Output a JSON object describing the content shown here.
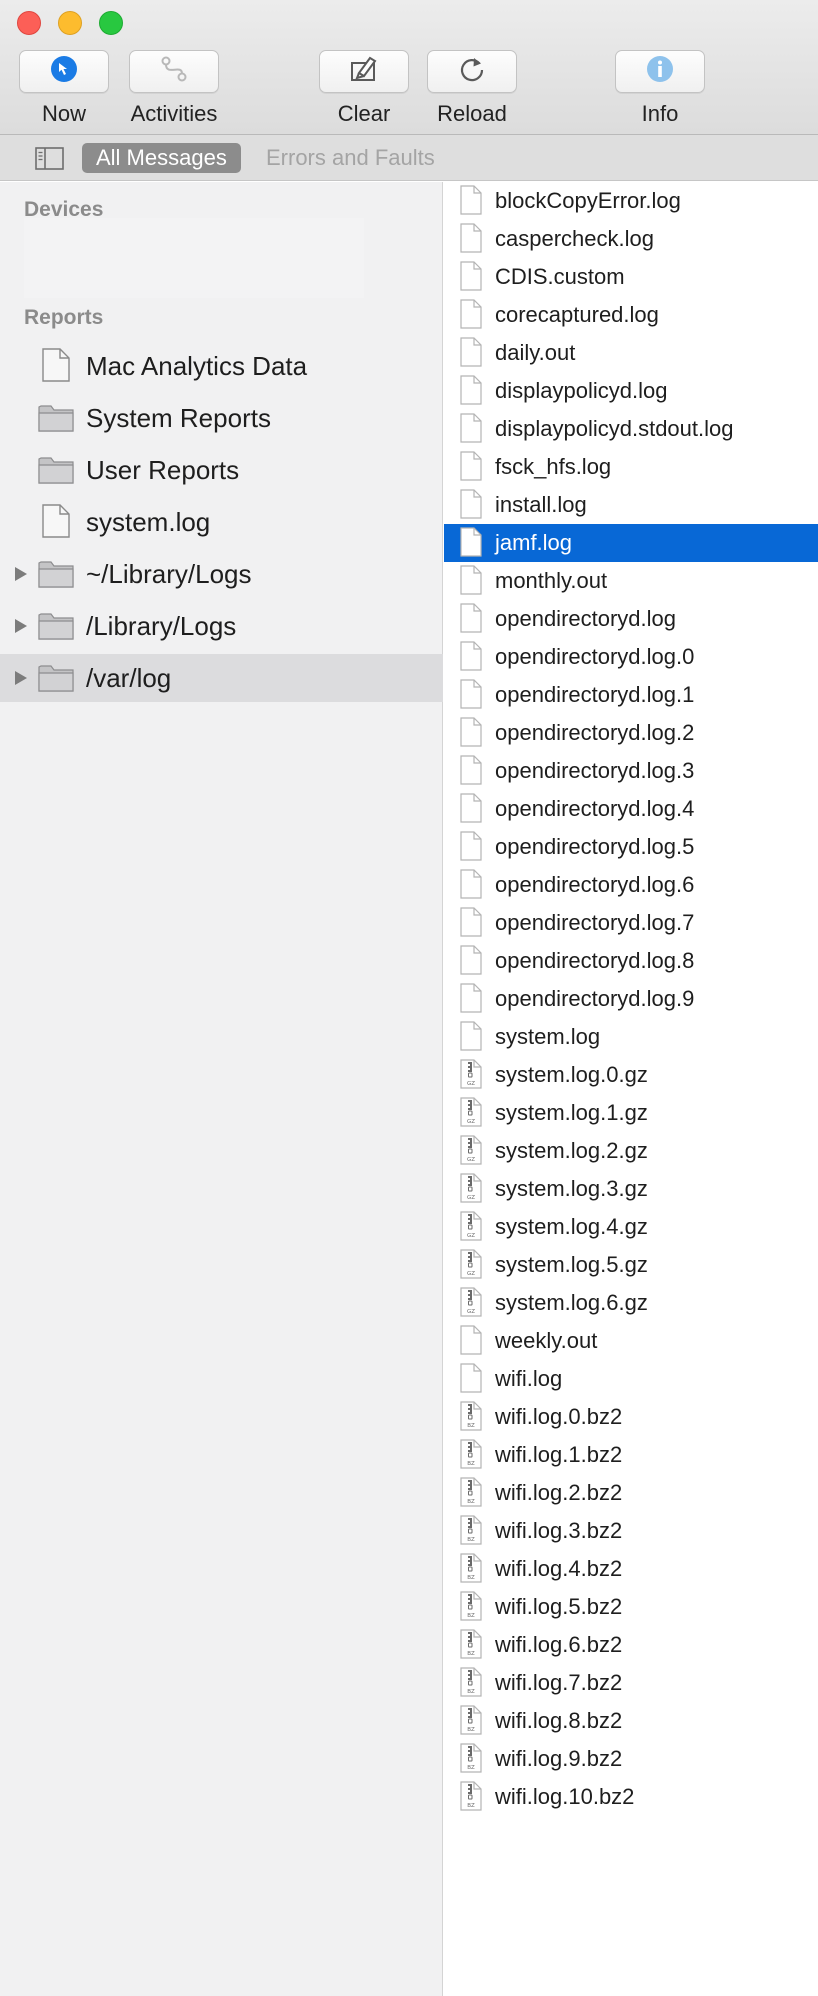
{
  "toolbar": {
    "buttons": [
      {
        "label": "Now",
        "icon": "now-arrow-icon"
      },
      {
        "label": "Activities",
        "icon": "activities-icon"
      },
      {
        "label": "Clear",
        "icon": "clear-icon"
      },
      {
        "label": "Reload",
        "icon": "reload-icon"
      },
      {
        "label": "Info",
        "icon": "info-icon"
      }
    ]
  },
  "filter_bar": {
    "all_messages": "All Messages",
    "errors_and_faults": "Errors and Faults"
  },
  "sidebar": {
    "devices_header": "Devices",
    "reports_header": "Reports",
    "items": [
      {
        "label": "Mac Analytics Data",
        "icon": "document-icon"
      },
      {
        "label": "System Reports",
        "icon": "folder-icon"
      },
      {
        "label": "User Reports",
        "icon": "folder-icon"
      },
      {
        "label": "system.log",
        "icon": "document-icon"
      },
      {
        "label": "~/Library/Logs",
        "icon": "folder-icon",
        "expandable": true
      },
      {
        "label": "/Library/Logs",
        "icon": "folder-icon",
        "expandable": true
      },
      {
        "label": "/var/log",
        "icon": "folder-icon",
        "expandable": true,
        "selected": true
      }
    ]
  },
  "files": [
    {
      "name": "blockCopyError.log",
      "type": "doc"
    },
    {
      "name": "caspercheck.log",
      "type": "doc"
    },
    {
      "name": "CDIS.custom",
      "type": "doc"
    },
    {
      "name": "corecaptured.log",
      "type": "doc"
    },
    {
      "name": "daily.out",
      "type": "doc"
    },
    {
      "name": "displaypolicyd.log",
      "type": "doc"
    },
    {
      "name": "displaypolicyd.stdout.log",
      "type": "doc"
    },
    {
      "name": "fsck_hfs.log",
      "type": "doc"
    },
    {
      "name": "install.log",
      "type": "doc"
    },
    {
      "name": "jamf.log",
      "type": "doc",
      "selected": true
    },
    {
      "name": "monthly.out",
      "type": "doc"
    },
    {
      "name": "opendirectoryd.log",
      "type": "doc"
    },
    {
      "name": "opendirectoryd.log.0",
      "type": "doc"
    },
    {
      "name": "opendirectoryd.log.1",
      "type": "doc"
    },
    {
      "name": "opendirectoryd.log.2",
      "type": "doc"
    },
    {
      "name": "opendirectoryd.log.3",
      "type": "doc"
    },
    {
      "name": "opendirectoryd.log.4",
      "type": "doc"
    },
    {
      "name": "opendirectoryd.log.5",
      "type": "doc"
    },
    {
      "name": "opendirectoryd.log.6",
      "type": "doc"
    },
    {
      "name": "opendirectoryd.log.7",
      "type": "doc"
    },
    {
      "name": "opendirectoryd.log.8",
      "type": "doc"
    },
    {
      "name": "opendirectoryd.log.9",
      "type": "doc"
    },
    {
      "name": "system.log",
      "type": "doc"
    },
    {
      "name": "system.log.0.gz",
      "type": "gz"
    },
    {
      "name": "system.log.1.gz",
      "type": "gz"
    },
    {
      "name": "system.log.2.gz",
      "type": "gz"
    },
    {
      "name": "system.log.3.gz",
      "type": "gz"
    },
    {
      "name": "system.log.4.gz",
      "type": "gz"
    },
    {
      "name": "system.log.5.gz",
      "type": "gz"
    },
    {
      "name": "system.log.6.gz",
      "type": "gz"
    },
    {
      "name": "weekly.out",
      "type": "doc"
    },
    {
      "name": "wifi.log",
      "type": "doc"
    },
    {
      "name": "wifi.log.0.bz2",
      "type": "bz"
    },
    {
      "name": "wifi.log.1.bz2",
      "type": "bz"
    },
    {
      "name": "wifi.log.2.bz2",
      "type": "bz"
    },
    {
      "name": "wifi.log.3.bz2",
      "type": "bz"
    },
    {
      "name": "wifi.log.4.bz2",
      "type": "bz"
    },
    {
      "name": "wifi.log.5.bz2",
      "type": "bz"
    },
    {
      "name": "wifi.log.6.bz2",
      "type": "bz"
    },
    {
      "name": "wifi.log.7.bz2",
      "type": "bz"
    },
    {
      "name": "wifi.log.8.bz2",
      "type": "bz"
    },
    {
      "name": "wifi.log.9.bz2",
      "type": "bz"
    },
    {
      "name": "wifi.log.10.bz2",
      "type": "bz"
    }
  ],
  "archive_labels": {
    "gz": "GZ",
    "bz": "BZ"
  },
  "colors": {
    "selection": "#0868d6",
    "accent": "#1a7be5"
  }
}
